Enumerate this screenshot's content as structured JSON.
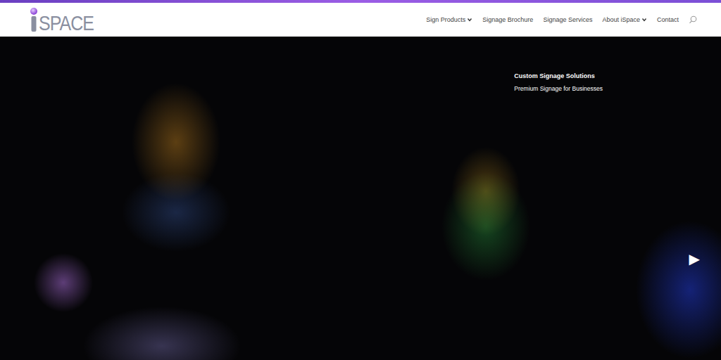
{
  "logo": {
    "text": "SPACE"
  },
  "nav": [
    {
      "label": "Sign Products",
      "dropdown": true
    },
    {
      "label": "Signage Brochure",
      "dropdown": false
    },
    {
      "label": "Signage Services",
      "dropdown": false
    },
    {
      "label": "About iSpace",
      "dropdown": true
    },
    {
      "label": "Contact",
      "dropdown": false
    }
  ],
  "hero": {
    "title": "Custom Signage Solutions",
    "subtitle": "Premium Signage for Businesses",
    "next_arrow": "▶"
  }
}
